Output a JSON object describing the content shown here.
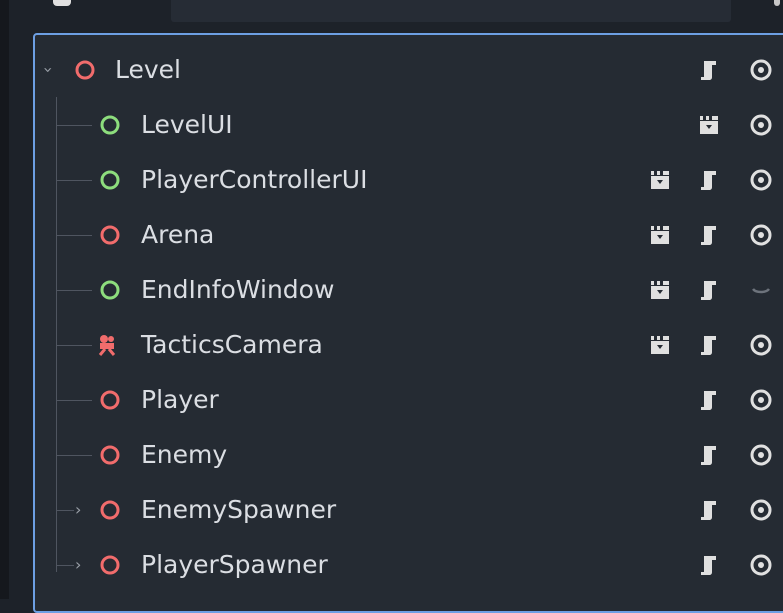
{
  "scene_tree": {
    "root": {
      "label": "Level",
      "icon": "node-red-circle"
    },
    "children": [
      {
        "label": "LevelUI",
        "color": "green",
        "icons": [
          "clapper-icon",
          "visibility-eye-icon"
        ]
      },
      {
        "label": "PlayerControllerUI",
        "color": "green",
        "icons": [
          "clapper-icon",
          "script-icon",
          "visibility-eye-icon"
        ]
      },
      {
        "label": "Arena",
        "color": "red",
        "icons": [
          "clapper-icon",
          "script-icon",
          "visibility-eye-icon"
        ]
      },
      {
        "label": "EndInfoWindow",
        "color": "green",
        "icons": [
          "clapper-icon",
          "script-icon",
          "hidden-eye-icon"
        ]
      },
      {
        "label": "TacticsCamera",
        "color": "camera",
        "icons": [
          "clapper-icon",
          "script-icon",
          "visibility-eye-icon"
        ]
      },
      {
        "label": "Player",
        "color": "red",
        "icons": [
          "script-icon",
          "visibility-eye-icon"
        ]
      },
      {
        "label": "Enemy",
        "color": "red",
        "icons": [
          "script-icon",
          "visibility-eye-icon"
        ]
      },
      {
        "label": "EnemySpawner",
        "color": "red",
        "collapsed": true,
        "icons": [
          "script-icon",
          "visibility-eye-icon"
        ]
      },
      {
        "label": "PlayerSpawner",
        "color": "red",
        "collapsed": true,
        "icons": [
          "script-icon",
          "visibility-eye-icon"
        ]
      }
    ]
  },
  "colors": {
    "red_node": "#f16c6c",
    "green_node": "#8ddd7d",
    "selection_border": "#6d9fe3",
    "icon_light": "#e0e0e0"
  }
}
